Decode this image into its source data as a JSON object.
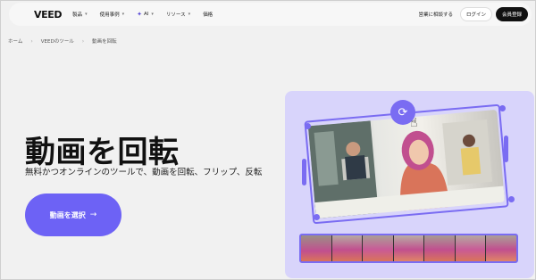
{
  "nav": {
    "logo": "VEED",
    "menu": [
      {
        "label": "製品",
        "has_dropdown": true
      },
      {
        "label": "使用事例",
        "has_dropdown": true
      },
      {
        "label": "AI",
        "has_dropdown": true,
        "icon": "sparkle-icon"
      },
      {
        "label": "リソース",
        "has_dropdown": true
      },
      {
        "label": "価格",
        "has_dropdown": false
      }
    ],
    "contact_sales": "営業に相談する",
    "login": "ログイン",
    "signup": "会員登録"
  },
  "breadcrumb": [
    "ホーム",
    "VEEDのツール",
    "動画を回転"
  ],
  "hero": {
    "title": "動画を回転",
    "subtitle": "無料かつオンラインのツールで、動画を回転、フリップ、反転",
    "cta_label": "動画を選択",
    "cta_arrow": "→"
  },
  "colors": {
    "accent": "#6d62f5",
    "illustration_bg": "#d8d4fb",
    "selection": "#7a6cf2",
    "signup_bg": "#111111"
  },
  "icons": {
    "rotate": "rotate-icon",
    "cursor": "hand-pointer-icon",
    "chevron": "chevron-down-icon"
  }
}
